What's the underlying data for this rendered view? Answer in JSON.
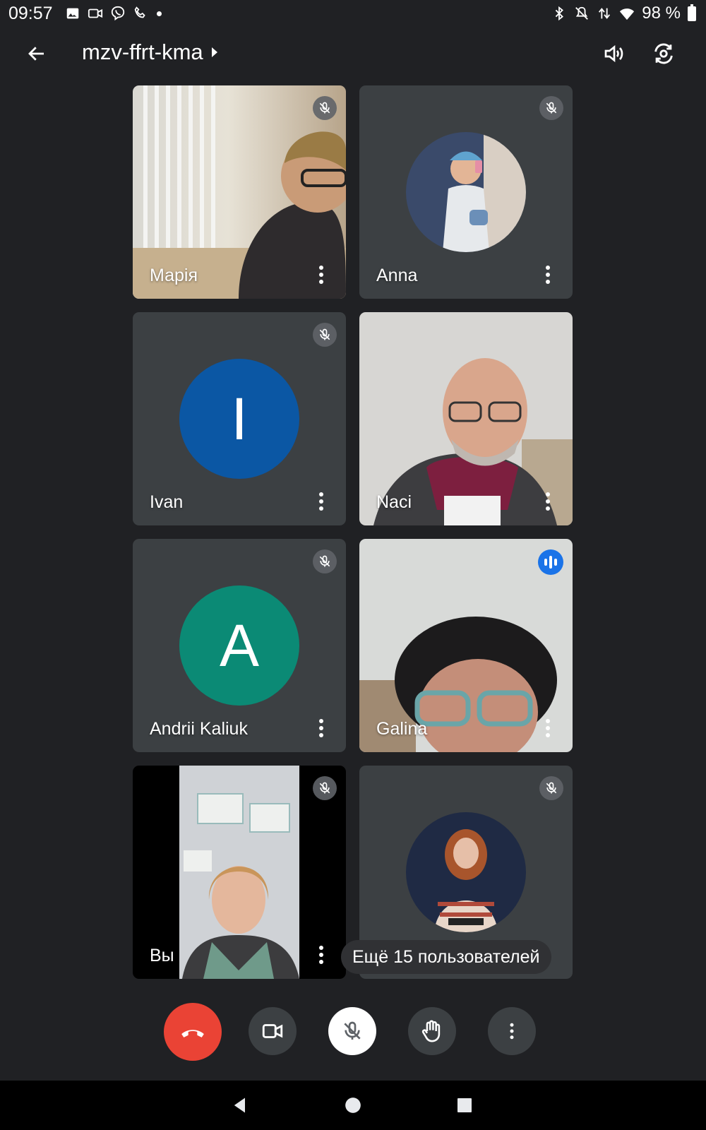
{
  "status_bar": {
    "time": "09:57",
    "battery": "98 %",
    "left_icons": [
      "image-icon",
      "video-icon",
      "viber-icon",
      "missed-call-icon",
      "dot-icon"
    ],
    "right_icons": [
      "bluetooth-icon",
      "mute-icon",
      "data-arrows-icon",
      "wifi-icon",
      "battery-icon"
    ]
  },
  "app_bar": {
    "title": "mzv-ffrt-kma",
    "icons": [
      "back-arrow-icon",
      "caret-right-icon",
      "speaker-icon",
      "switch-camera-icon"
    ]
  },
  "participants": [
    {
      "name": "Марія",
      "mic": "muted",
      "display": "video"
    },
    {
      "name": "Anna",
      "mic": "muted",
      "display": "photo-avatar"
    },
    {
      "name": "Ivan",
      "mic": "muted",
      "display": "letter-avatar",
      "initial": "I",
      "color": "#0b57a4"
    },
    {
      "name": "Naci",
      "mic": "on",
      "display": "video"
    },
    {
      "name": "Andrii Kaliuk",
      "mic": "muted",
      "display": "letter-avatar",
      "initial": "A",
      "color": "#0b8a75"
    },
    {
      "name": "Galina",
      "mic": "speaking",
      "display": "video"
    },
    {
      "name": "Вы",
      "mic": "muted",
      "display": "video"
    },
    {
      "name": "",
      "mic": "muted",
      "display": "photo-avatar"
    }
  ],
  "more_users_label": "Ещё 15 пользователей",
  "controls": {
    "buttons": [
      "end-call-icon",
      "camera-icon",
      "mic-off-icon",
      "raise-hand-icon",
      "more-vert-icon"
    ],
    "end_call_color": "#ea4335"
  },
  "nav_bar": {
    "buttons": [
      "nav-back-icon",
      "nav-home-icon",
      "nav-recents-icon"
    ]
  }
}
